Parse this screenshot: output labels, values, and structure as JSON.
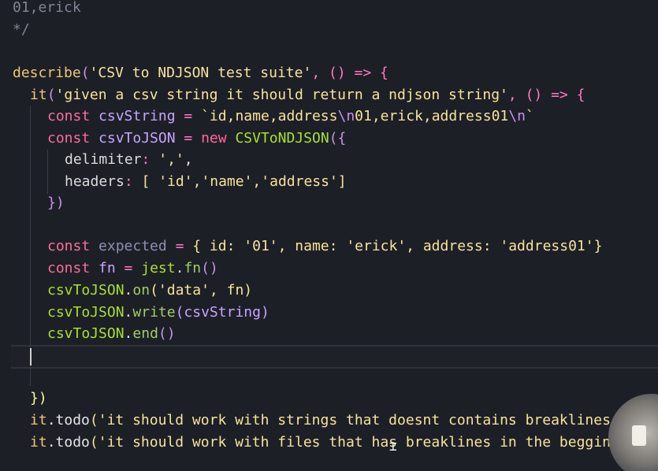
{
  "code": {
    "lines": [
      {
        "text": "01,erick"
      },
      {
        "text": "*/"
      },
      {
        "text": ""
      },
      {
        "describe_kw": "describe",
        "describe_str": "'CSV to NDJSON test suite'",
        "tail": ", () => {"
      },
      {
        "it_kw": "it",
        "it_str": "'given a csv string it should return a ndjson string'",
        "tail": ", () => {"
      },
      {
        "const": "const",
        "name": "csvString",
        "eq": " = ",
        "tmpl_a": "`id,name,address",
        "esc1": "\\n",
        "tmpl_b": "01,erick,address01",
        "esc2": "\\n",
        "tmpl_c": "`"
      },
      {
        "const": "const",
        "name": "csvToJSON",
        "eq": " = ",
        "new": "new",
        "cls": "CSVToNDJSON",
        "tail": "({"
      },
      {
        "key": "delimiter",
        "sep": ": ",
        "val": "','",
        "tail": ","
      },
      {
        "key": "headers",
        "sep": ": ",
        "arr": "[ 'id','name','address']"
      },
      {
        "text": "})"
      },
      {
        "text": ""
      },
      {
        "const": "const",
        "name": "expected",
        "eq": " = ",
        "obj": "{ id: '01', name: 'erick', address: 'address01'}"
      },
      {
        "const": "const",
        "name": "fn",
        "eq": " = ",
        "obj": "jest",
        "dot": ".",
        "method": "fn",
        "tail": "()"
      },
      {
        "obj": "csvToJSON",
        "dot": ".",
        "method": "on",
        "args": "('data', fn)"
      },
      {
        "obj": "csvToJSON",
        "dot": ".",
        "method": "write",
        "args": "(csvString)"
      },
      {
        "obj": "csvToJSON",
        "dot": ".",
        "method": "end",
        "args": "()"
      },
      {
        "text": ""
      },
      {
        "text": ""
      },
      {
        "text": "})"
      },
      {
        "obj": "it",
        "dot": ".",
        "method": "todo",
        "args": "('it should work with strings that doesnt contains breaklines"
      },
      {
        "obj": "it",
        "dot": ".",
        "method": "todo",
        "args": "('it should work with files that has breaklines in the beggin"
      }
    ]
  },
  "colors": {
    "background": "#1d1f26",
    "comment": "#7f8593",
    "keyword": "#ff6b9a",
    "string": "#f7e39b",
    "function": "#f0c674"
  }
}
